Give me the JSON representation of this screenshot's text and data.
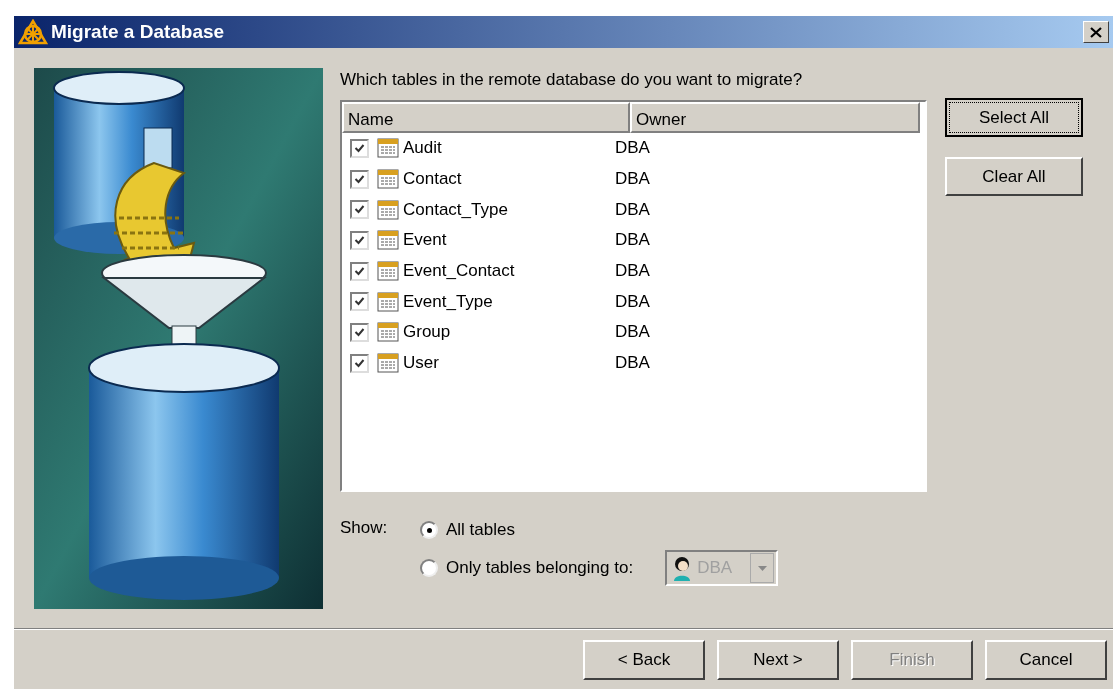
{
  "window": {
    "title": "Migrate a Database"
  },
  "prompt": "Which tables in the remote database do you want to migrate?",
  "table": {
    "columns": [
      "Name",
      "Owner"
    ],
    "rows": [
      {
        "name": "Audit",
        "owner": "DBA",
        "checked": true
      },
      {
        "name": "Contact",
        "owner": "DBA",
        "checked": true
      },
      {
        "name": "Contact_Type",
        "owner": "DBA",
        "checked": true
      },
      {
        "name": "Event",
        "owner": "DBA",
        "checked": true
      },
      {
        "name": "Event_Contact",
        "owner": "DBA",
        "checked": true
      },
      {
        "name": "Event_Type",
        "owner": "DBA",
        "checked": true
      },
      {
        "name": "Group",
        "owner": "DBA",
        "checked": true
      },
      {
        "name": "User",
        "owner": "DBA",
        "checked": true
      }
    ]
  },
  "side_buttons": [
    {
      "label": "Select All",
      "focused": true
    },
    {
      "label": "Clear All",
      "focused": false
    }
  ],
  "show": {
    "label": "Show:",
    "options": [
      {
        "label": "All tables",
        "selected": true
      },
      {
        "label": "Only tables belonging to:",
        "selected": false
      }
    ],
    "owner_dropdown": {
      "value": "DBA",
      "disabled": true
    }
  },
  "buttons": [
    {
      "label": "< Back",
      "disabled": false
    },
    {
      "label": "Next >",
      "disabled": false
    },
    {
      "label": "Finish",
      "disabled": true
    },
    {
      "label": "Cancel",
      "disabled": false
    }
  ]
}
